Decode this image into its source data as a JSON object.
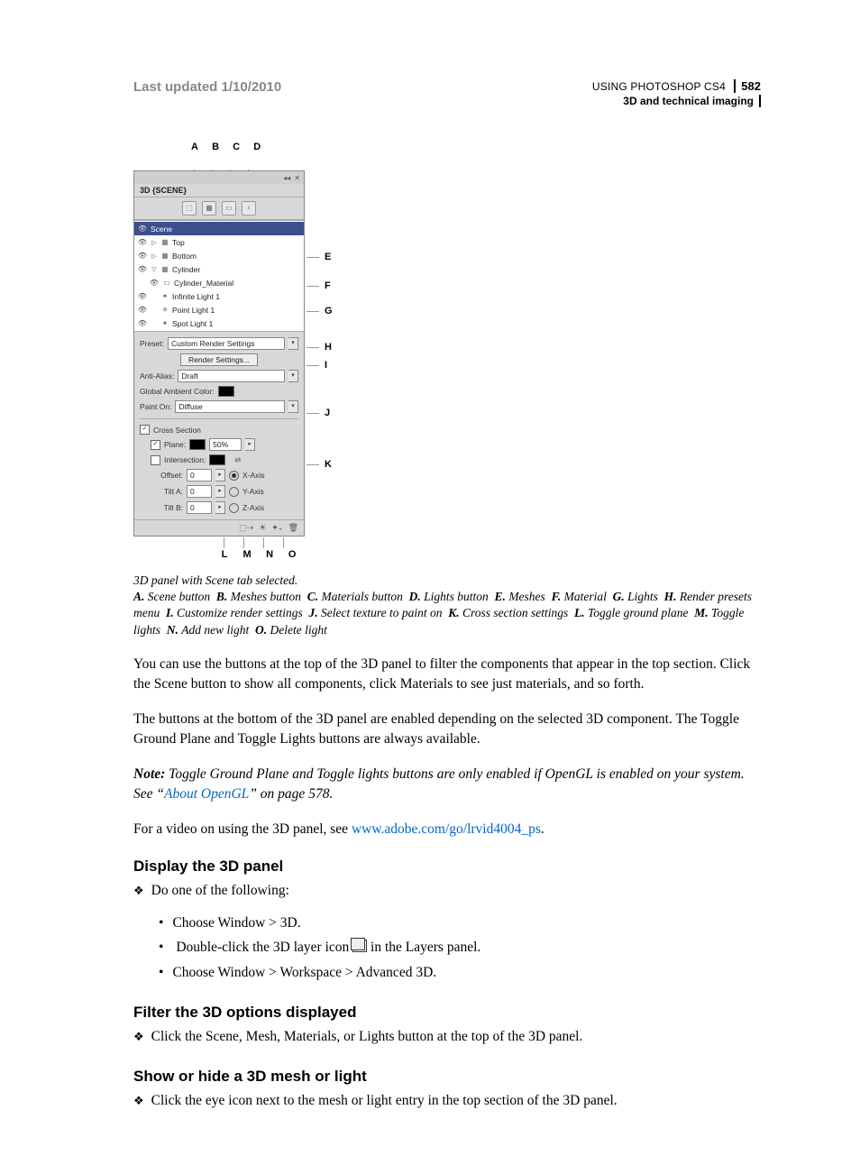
{
  "header": {
    "last_updated": "Last updated 1/10/2010",
    "doc_title": "USING PHOTOSHOP CS4",
    "page_number": "582",
    "section": "3D and technical imaging"
  },
  "figure": {
    "top_letters": [
      "A",
      "B",
      "C",
      "D"
    ],
    "bottom_letters": [
      "L",
      "M",
      "N",
      "O"
    ],
    "right_letters": [
      "E",
      "F",
      "G",
      "H",
      "I",
      "J",
      "K"
    ],
    "panel": {
      "title": "3D {SCENE}",
      "tree": [
        {
          "label": "Scene",
          "selected": true
        },
        {
          "label": "Top",
          "indent": 1
        },
        {
          "label": "Bottom",
          "indent": 1
        },
        {
          "label": "Cylinder",
          "indent": 1,
          "expanded": true
        },
        {
          "label": "Cylinder_Material",
          "indent": 2,
          "icon": "material"
        },
        {
          "label": "Infinite Light 1",
          "indent": 1,
          "icon": "light"
        },
        {
          "label": "Point Light 1",
          "indent": 1,
          "icon": "light"
        },
        {
          "label": "Spot Light 1",
          "indent": 1,
          "icon": "light"
        }
      ],
      "preset_label": "Preset:",
      "preset_value": "Custom Render Settings",
      "render_btn": "Render Settings...",
      "antialias_label": "Anti-Alias:",
      "antialias_value": "Draft",
      "ambient_label": "Global Ambient Color:",
      "painton_label": "Paint On:",
      "painton_value": "Diffuse",
      "crosssection_label": "Cross Section",
      "plane_label": "Plane:",
      "plane_value": "50%",
      "intersection_label": "Intersection:",
      "offset_label": "Offset:",
      "offset_value": "0",
      "tilta_label": "Tilt A:",
      "tilta_value": "0",
      "tiltb_label": "Tilt B:",
      "tiltb_value": "0",
      "xaxis": "X-Axis",
      "yaxis": "Y-Axis",
      "zaxis": "Z-Axis"
    }
  },
  "caption": {
    "title": "3D panel with Scene tab selected.",
    "keys": {
      "A": "Scene button",
      "B": "Meshes button",
      "C": "Materials button",
      "D": "Lights button",
      "E": "Meshes",
      "F": "Material",
      "G": "Lights",
      "H": "Render presets menu",
      "I": "Customize render settings",
      "J": "Select texture to paint on",
      "K": "Cross section settings",
      "L": "Toggle ground plane",
      "M": "Toggle lights",
      "N": "Add new light",
      "O": "Delete light"
    }
  },
  "body": {
    "p1": "You can use the buttons at the top of the 3D panel to filter the components that appear in the top section. Click the Scene button to show all components, click Materials to see just materials, and so forth.",
    "p2": "The buttons at the bottom of the 3D panel are enabled depending on the selected 3D component. The Toggle Ground Plane and Toggle Lights buttons are always available.",
    "note_lead": "Note:",
    "note_text_a": "Toggle Ground Plane and Toggle lights buttons are only enabled if OpenGL is enabled on your system. See “",
    "note_link": "About OpenGL",
    "note_text_b": "” on page 578.",
    "p3a": "For a video on using the 3D panel, see ",
    "p3_link": "www.adobe.com/go/lrvid4004_ps",
    "p3b": "."
  },
  "sections": {
    "s1_title": "Display the 3D panel",
    "s1_lead": "Do one of the following:",
    "s1_items": [
      "Choose Window > 3D.",
      "Double-click the 3D layer icon ",
      " in the Layers panel.",
      "Choose Window > Workspace > Advanced 3D."
    ],
    "s2_title": "Filter the 3D options displayed",
    "s2_item": "Click the Scene, Mesh, Materials, or Lights button at the top of the 3D panel.",
    "s3_title": "Show or hide a 3D mesh or light",
    "s3_item": "Click the eye icon next to the mesh or light entry in the top section of the 3D panel."
  }
}
